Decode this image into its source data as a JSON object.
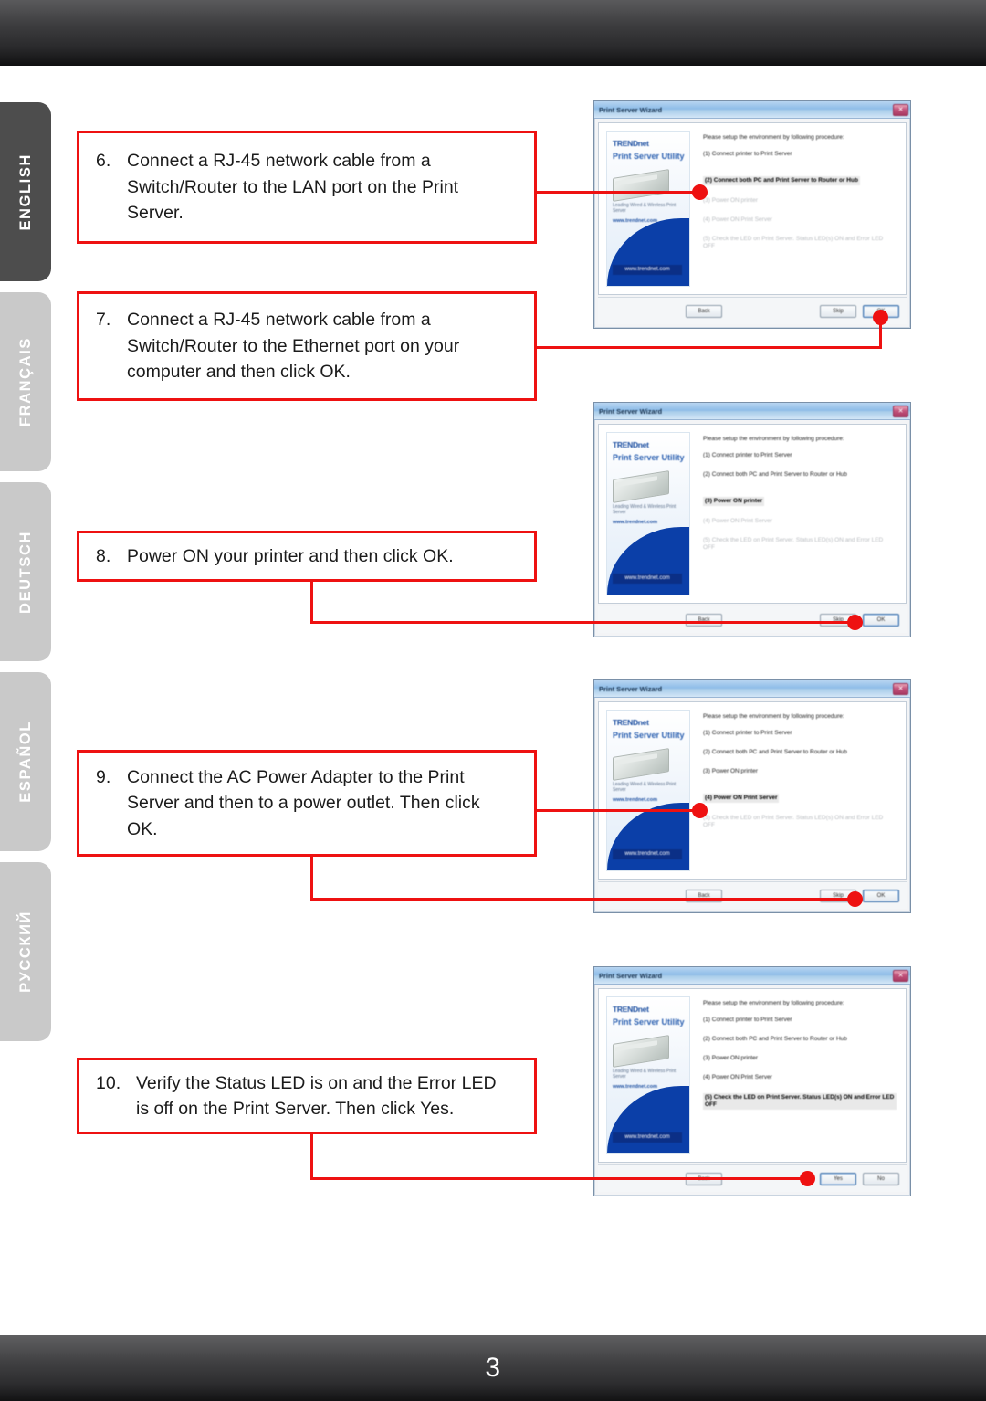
{
  "document": {
    "page_number": "3"
  },
  "sidebar": {
    "items": [
      {
        "label": "ENGLISH",
        "active": true
      },
      {
        "label": "FRANÇAIS",
        "active": false
      },
      {
        "label": "DEUTSCH",
        "active": false
      },
      {
        "label": "ESPAÑOL",
        "active": false
      },
      {
        "label": "РУССКИЙ",
        "active": false
      }
    ]
  },
  "colors": {
    "callout_red": "#ee1111",
    "sidebar_active": "#4d4d4d",
    "sidebar_inactive": "#c9c9c9",
    "bar_dark": "#2a2a2c"
  },
  "steps": [
    {
      "number": "6.",
      "lines": [
        "Connect a RJ-45 network cable from a",
        "Switch/Router to the LAN port on the Print",
        "Server."
      ]
    },
    {
      "number": "7.",
      "lines": [
        "Connect a RJ-45 network cable from a",
        "Switch/Router to the Ethernet port on your",
        "computer and then click OK."
      ]
    },
    {
      "number": "8.",
      "lines": [
        "Power ON your printer and then click OK."
      ]
    },
    {
      "number": "9.",
      "lines": [
        "Connect the AC Power Adapter to the Print",
        "Server and then to a power outlet. Then click",
        "OK."
      ]
    },
    {
      "number": "10.",
      "lines": [
        "Verify the Status LED is on and the Error LED",
        "is off on the Print Server.  Then click Yes."
      ]
    }
  ],
  "dialogs": [
    {
      "title": "Print Server Wizard",
      "close_glyph": "✕",
      "brand": "TRENDnet",
      "brand_sub": "Print Server Utility",
      "url": "www.trendnet.com",
      "banner_note": "Leading Wired & Wireless Print Server",
      "banner_note2": "www.trendnet.com",
      "heading": "Please setup the environment by following procedure:",
      "items": [
        {
          "text": "(1) Connect printer to Print Server",
          "state": "done"
        },
        {
          "text": "(2) Connect both PC and Print Server to Router or Hub",
          "state": "highlight"
        },
        {
          "text": "(3) Power ON printer",
          "state": "dim"
        },
        {
          "text": "(4) Power ON Print Server",
          "state": "dim"
        },
        {
          "text": "(5) Check the LED on Print Server. Status LED(s) ON and Error LED OFF",
          "state": "dim"
        }
      ],
      "buttons": {
        "back": "Back",
        "skip": "Skip",
        "ok": "OK"
      }
    },
    {
      "title": "Print Server Wizard",
      "close_glyph": "✕",
      "brand": "TRENDnet",
      "brand_sub": "Print Server Utility",
      "url": "www.trendnet.com",
      "banner_note": "Leading Wired & Wireless Print Server",
      "banner_note2": "www.trendnet.com",
      "heading": "Please setup the environment by following procedure:",
      "items": [
        {
          "text": "(1) Connect printer to Print Server",
          "state": "done"
        },
        {
          "text": "(2) Connect both PC and Print Server to Router or Hub",
          "state": "done"
        },
        {
          "text": "(3) Power ON printer",
          "state": "highlight"
        },
        {
          "text": "(4) Power ON Print Server",
          "state": "dim"
        },
        {
          "text": "(5) Check the LED on Print Server. Status LED(s) ON and Error LED OFF",
          "state": "dim"
        }
      ],
      "buttons": {
        "back": "Back",
        "skip": "Skip",
        "ok": "OK"
      }
    },
    {
      "title": "Print Server Wizard",
      "close_glyph": "✕",
      "brand": "TRENDnet",
      "brand_sub": "Print Server Utility",
      "url": "www.trendnet.com",
      "banner_note": "Leading Wired & Wireless Print Server",
      "banner_note2": "www.trendnet.com",
      "heading": "Please setup the environment by following procedure:",
      "items": [
        {
          "text": "(1) Connect printer to Print Server",
          "state": "done"
        },
        {
          "text": "(2) Connect both PC and Print Server to Router or Hub",
          "state": "done"
        },
        {
          "text": "(3) Power ON printer",
          "state": "done"
        },
        {
          "text": "(4) Power ON Print Server",
          "state": "highlight"
        },
        {
          "text": "(5) Check the LED on Print Server. Status LED(s) ON and Error LED OFF",
          "state": "dim"
        }
      ],
      "buttons": {
        "back": "Back",
        "skip": "Skip",
        "ok": "OK"
      }
    },
    {
      "title": "Print Server Wizard",
      "close_glyph": "✕",
      "brand": "TRENDnet",
      "brand_sub": "Print Server Utility",
      "url": "www.trendnet.com",
      "banner_note": "Leading Wired & Wireless Print Server",
      "banner_note2": "www.trendnet.com",
      "heading": "Please setup the environment by following procedure:",
      "items": [
        {
          "text": "(1) Connect printer to Print Server",
          "state": "done"
        },
        {
          "text": "(2) Connect both PC and Print Server to Router or Hub",
          "state": "done"
        },
        {
          "text": "(3) Power ON printer",
          "state": "done"
        },
        {
          "text": "(4) Power ON Print Server",
          "state": "done"
        },
        {
          "text": "(5) Check the LED on Print Server. Status LED(s) ON and Error LED OFF",
          "state": "highlight"
        }
      ],
      "buttons": {
        "back": "Back",
        "skip": "Yes",
        "ok": "No"
      }
    }
  ]
}
